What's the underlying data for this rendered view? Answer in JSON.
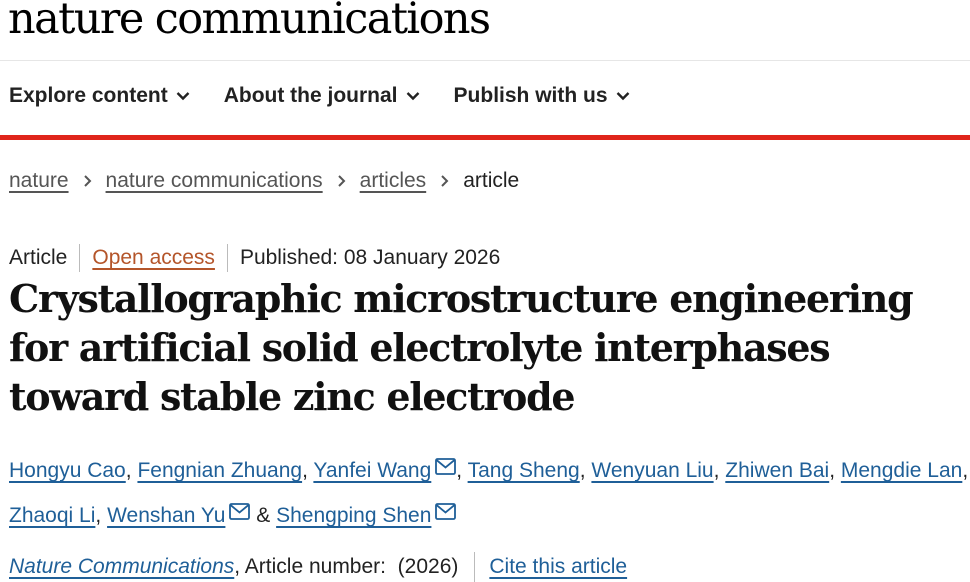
{
  "site": {
    "logo": "nature communications"
  },
  "nav": {
    "items": [
      {
        "label": "Explore content"
      },
      {
        "label": "About the journal"
      },
      {
        "label": "Publish with us"
      }
    ]
  },
  "breadcrumb": {
    "items": [
      "nature",
      "nature communications",
      "articles"
    ],
    "current": "article"
  },
  "meta": {
    "type": "Article",
    "access": "Open access",
    "published": "Published: 08 January 2026"
  },
  "article": {
    "title": "Crystallographic microstructure engineering for artificial solid electrolyte interphases toward stable zinc electrode"
  },
  "authors": [
    {
      "name": "Hongyu Cao",
      "email": false
    },
    {
      "name": "Fengnian Zhuang",
      "email": false
    },
    {
      "name": "Yanfei Wang",
      "email": true
    },
    {
      "name": "Tang Sheng",
      "email": false
    },
    {
      "name": "Wenyuan Liu",
      "email": false
    },
    {
      "name": "Zhiwen Bai",
      "email": false
    },
    {
      "name": "Mengdie Lan",
      "email": false
    },
    {
      "name": "Zhaoqi Li",
      "email": false
    },
    {
      "name": "Wenshan Yu",
      "email": true
    },
    {
      "name": "Shengping Shen",
      "email": true
    }
  ],
  "authors_separators": {
    "comma": ",",
    "and": "&"
  },
  "citation": {
    "journal": "Nature Communications",
    "article_number": ", Article number:  (2026)",
    "cite_label": "Cite this article"
  },
  "colors": {
    "accent_red": "#e0251b",
    "link_blue": "#1f5f98",
    "open_access": "#b4552a"
  },
  "icons": {
    "nav_chevron": "chevron-down-icon",
    "breadcrumb_separator": "chevron-right-icon",
    "author_email": "mail-icon"
  }
}
